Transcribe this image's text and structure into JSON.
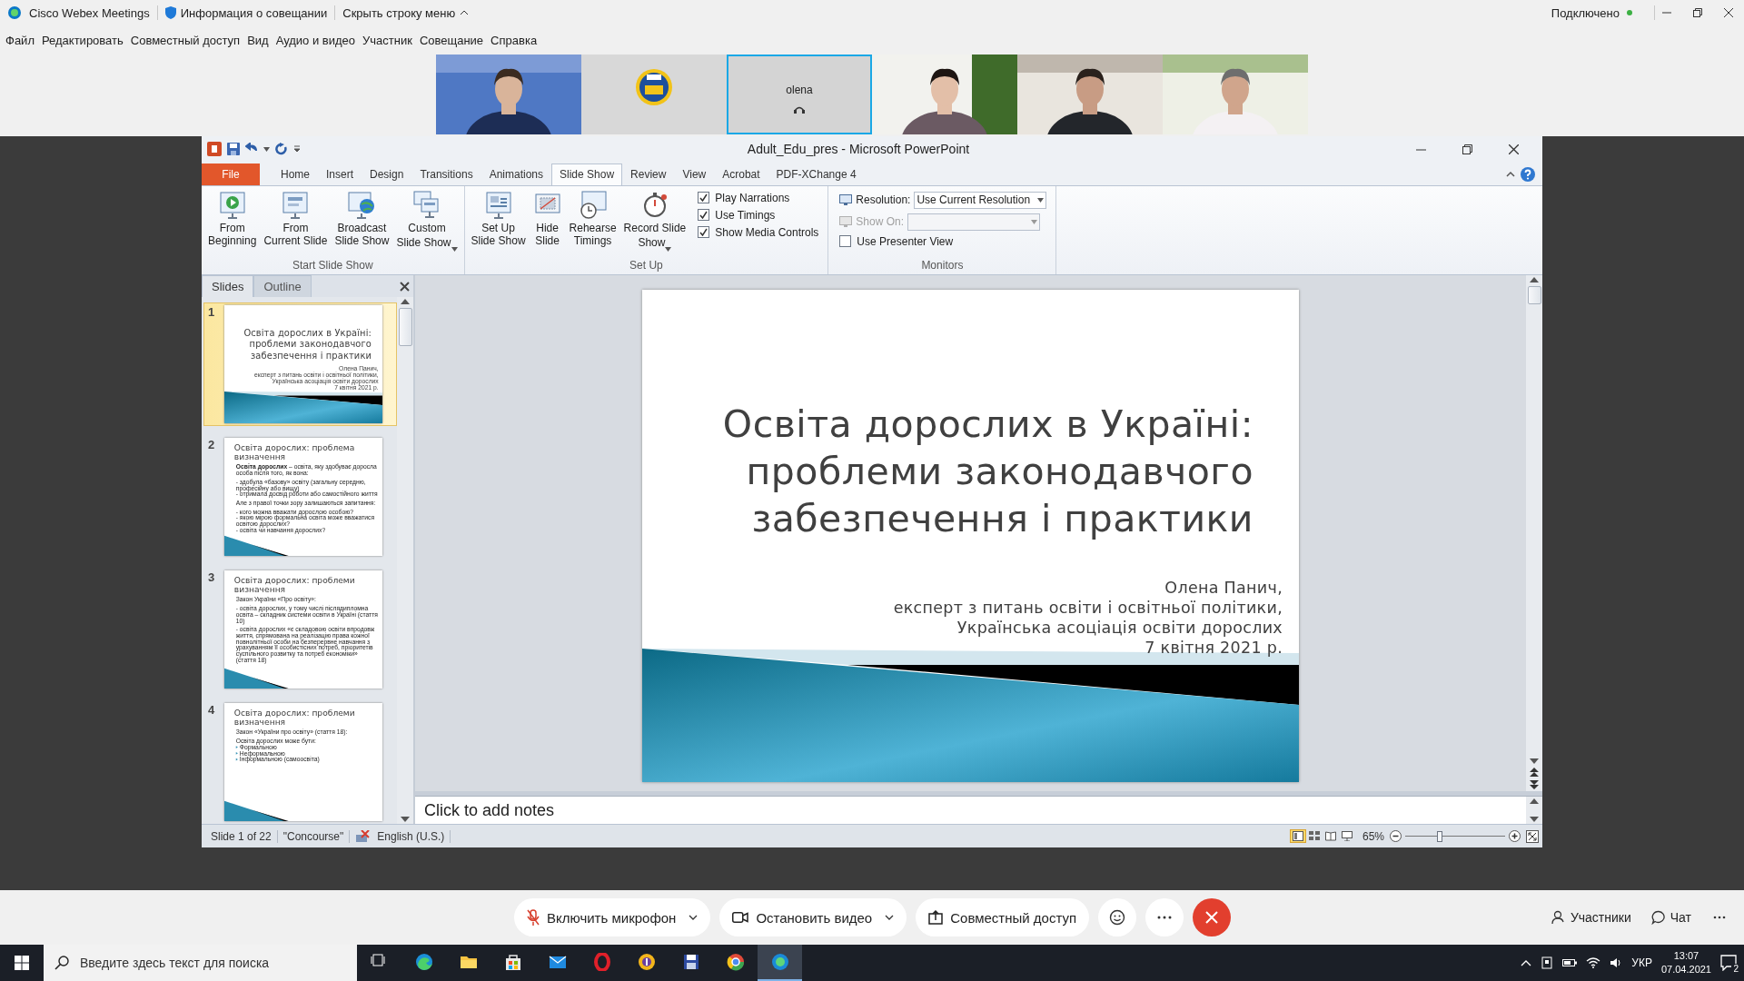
{
  "webex_bar": {
    "app_name": "Cisco Webex Meetings",
    "meeting_info": "Информация о совещании",
    "hide_menu": "Скрыть строку меню",
    "status": "Подключено"
  },
  "menu": [
    "Файл",
    "Редактировать",
    "Совместный доступ",
    "Вид",
    "Аудио и видео",
    "Участник",
    "Совещание",
    "Справка"
  ],
  "video_tiles": [
    {
      "kind": "picture",
      "active": false
    },
    {
      "kind": "picture",
      "active": false
    },
    {
      "kind": "name",
      "name": "olena",
      "active": true
    },
    {
      "kind": "picture",
      "active": false
    },
    {
      "kind": "picture",
      "active": false
    },
    {
      "kind": "picture",
      "active": false
    }
  ],
  "powerpoint": {
    "title": "Adult_Edu_pres - Microsoft PowerPoint",
    "tabs": [
      {
        "kind": "file",
        "label": "File",
        "selected": false
      },
      {
        "kind": "tab",
        "label": "Home",
        "selected": false
      },
      {
        "kind": "tab",
        "label": "Insert",
        "selected": false
      },
      {
        "kind": "tab",
        "label": "Design",
        "selected": false
      },
      {
        "kind": "tab",
        "label": "Transitions",
        "selected": false
      },
      {
        "kind": "tab",
        "label": "Animations",
        "selected": false
      },
      {
        "kind": "tab",
        "label": "Slide Show",
        "selected": true
      },
      {
        "kind": "tab",
        "label": "Review",
        "selected": false
      },
      {
        "kind": "tab",
        "label": "View",
        "selected": false
      },
      {
        "kind": "tab",
        "label": "Acrobat",
        "selected": false
      },
      {
        "kind": "tab",
        "label": "PDF-XChange 4",
        "selected": false
      }
    ],
    "ribbon_groups": [
      {
        "label": "Start Slide Show",
        "items": [
          {
            "kind": "large",
            "lines": [
              "From",
              "Beginning"
            ],
            "dropdown": false
          },
          {
            "kind": "large",
            "lines": [
              "From",
              "Current Slide"
            ],
            "dropdown": false
          },
          {
            "kind": "large",
            "lines": [
              "Broadcast",
              "Slide Show"
            ],
            "dropdown": false
          },
          {
            "kind": "large",
            "lines": [
              "Custom",
              "Slide Show"
            ],
            "dropdown": true
          }
        ]
      },
      {
        "label": "Set Up",
        "items": [
          {
            "kind": "large",
            "lines": [
              "Set Up",
              "Slide Show"
            ],
            "dropdown": false
          },
          {
            "kind": "large",
            "lines": [
              "Hide",
              "Slide"
            ],
            "dropdown": false
          },
          {
            "kind": "large",
            "lines": [
              "Rehearse",
              "Timings"
            ],
            "dropdown": false
          },
          {
            "kind": "large",
            "lines": [
              "Record Slide",
              "Show"
            ],
            "dropdown": true
          },
          {
            "kind": "stack",
            "rows": [
              {
                "kind": "checkbox",
                "label": "Play Narrations",
                "checked": true
              },
              {
                "kind": "checkbox",
                "label": "Use Timings",
                "checked": true
              },
              {
                "kind": "checkbox",
                "label": "Show Media Controls",
                "checked": true
              }
            ]
          }
        ]
      },
      {
        "label": "Monitors",
        "items": [
          {
            "kind": "stack",
            "rows": [
              {
                "kind": "select",
                "label": "Resolution:",
                "value": "Use Current Resolution",
                "disabled": false
              },
              {
                "kind": "select",
                "label": "Show On:",
                "disabled": true
              },
              {
                "kind": "checkbox",
                "label": "Use Presenter View",
                "checked": false
              }
            ]
          }
        ]
      }
    ],
    "pane_tabs": [
      {
        "label": "Slides",
        "selected": true
      },
      {
        "label": "Outline",
        "selected": false
      }
    ],
    "slides": [
      {
        "number": "1",
        "selected": true,
        "kind": "title",
        "title_lines": [
          "Освіта дорослих в Україні:",
          "проблеми законодавчого",
          "забезпечення і практики"
        ],
        "subtitle_lines": [
          "Олена Панич,",
          "експерт з питань освіти і освітньої політики,",
          "Українська асоціація освіти дорослих",
          "7 квітня 2021 р."
        ]
      },
      {
        "number": "2",
        "selected": false,
        "kind": "content",
        "title": "Освіта дорослих: проблема визначення",
        "body": [
          {
            "kind": "para",
            "text": "**Освіта дорослих** – освіта, яку здобуває доросла особа після того, як вона:",
            "spaced": false
          },
          {
            "kind": "para",
            "text": "- здобула «базову» освіту (загальну середню, професійну або вищу)",
            "spaced": true
          },
          {
            "kind": "para",
            "text": "- отримала досвід роботи або самостійного життя",
            "spaced": false
          },
          {
            "kind": "para",
            "text": "Але з правої точки зору залишаються запитання:",
            "spaced": true
          },
          {
            "kind": "para",
            "text": "- кого можна вважати дорослою особою?",
            "spaced": true
          },
          {
            "kind": "para",
            "text": "- якою мірою формальна освіта може вважатися освітою дорослих?",
            "spaced": false
          },
          {
            "kind": "para",
            "text": "- освіта чи навчання дорослих?",
            "spaced": false
          }
        ]
      },
      {
        "number": "3",
        "selected": false,
        "kind": "content",
        "title": "Освіта дорослих: проблеми визначення",
        "body": [
          {
            "kind": "para",
            "text": "Закон України «Про освіту»:",
            "spaced": false
          },
          {
            "kind": "para",
            "text": "- освіта дорослих, у тому числі післядипломна освіта – складник системи освіти в Україні (стаття 10)",
            "spaced": true
          },
          {
            "kind": "para",
            "text": "- освіта дорослих «є складовою освіти впродовж життя, спрямована на реалізацію права кожної повнолітньої особи на безперервне навчання з урахуванням її особистісних потреб, пріоритетів суспільного розвитку та потреб економіки» (стаття 18)",
            "spaced": true
          }
        ]
      },
      {
        "number": "4",
        "selected": false,
        "kind": "content",
        "title": "Освіта дорослих: проблеми визначення",
        "body": [
          {
            "kind": "para",
            "text": "Закон «України про освіту» (стаття 18):",
            "spaced": false
          },
          {
            "kind": "para",
            "text": "Освіта дорослих може бути:",
            "spaced": true
          },
          {
            "kind": "bullet",
            "text": "Формальною",
            "spaced": false
          },
          {
            "kind": "bullet",
            "text": "Неформальною",
            "spaced": false
          },
          {
            "kind": "bullet",
            "text": "Інформальною (самоосвіта)",
            "spaced": false
          }
        ]
      }
    ],
    "current_slide": {
      "kind": "title",
      "title_lines": [
        "Освіта дорослих в Україні:",
        "проблеми законодавчого",
        "забезпечення і практики"
      ],
      "subtitle_lines": [
        "Олена Панич,",
        "експерт з питань освіти і освітньої політики,",
        "Українська асоціація освіти дорослих",
        "7 квітня 2021 р."
      ]
    },
    "notes": {
      "placeholder": "Click to add notes"
    },
    "status_bar": {
      "slide": "Slide 1 of 22",
      "theme": "\"Concourse\"",
      "language": "English (U.S.)",
      "views": [
        {
          "selected": true
        },
        {
          "selected": false
        },
        {
          "selected": false
        },
        {
          "selected": false
        }
      ],
      "zoom": "65%",
      "zoom_slider": {
        "level": 0.35
      }
    }
  },
  "controls": {
    "buttons": [
      {
        "label": "Включить микрофон",
        "dropdown": true
      },
      {
        "label": "Остановить видео",
        "dropdown": true
      },
      {
        "label": "Совместный доступ",
        "dropdown": false
      }
    ],
    "right": [
      {
        "label": "Участники"
      },
      {
        "label": "Чат"
      }
    ]
  },
  "taskbar": {
    "search_placeholder": "Введите здесь текст для поиска",
    "apps": [
      {
        "active": false
      },
      {
        "active": false
      },
      {
        "active": false
      },
      {
        "active": false
      },
      {
        "active": false
      },
      {
        "active": false
      },
      {
        "active": false
      },
      {
        "active": false
      },
      {
        "active": false
      },
      {
        "active": true
      }
    ],
    "language": "УКР",
    "time": "13:07",
    "date": "07.04.2021",
    "notifications": "2"
  }
}
